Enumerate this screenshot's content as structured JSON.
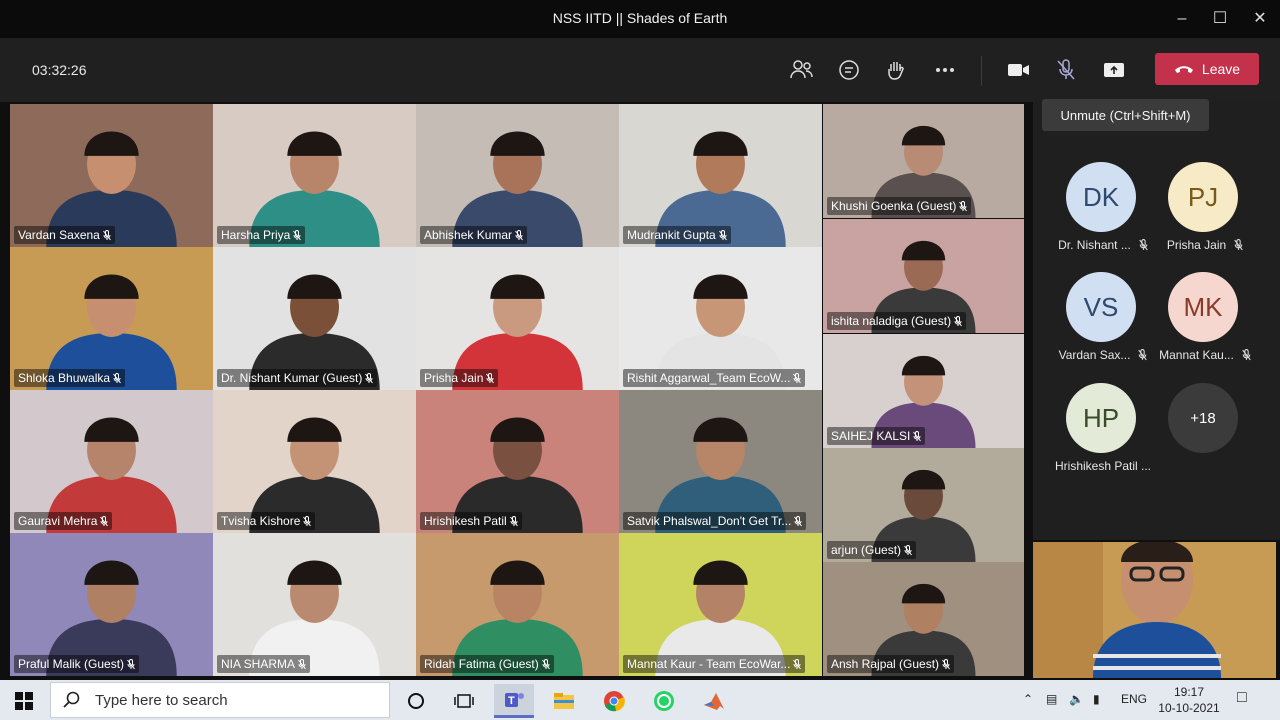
{
  "window": {
    "title": "NSS IITD || Shades of Earth",
    "minimize_icon": "minimize-icon",
    "maximize_icon": "maximize-icon",
    "close_icon": "close-icon"
  },
  "toolbar": {
    "timer": "03:32:26",
    "leave_label": "Leave",
    "tooltip": "Unmute (Ctrl+Shift+M)",
    "icons": [
      "participants-icon",
      "chat-icon",
      "raise-hand-icon",
      "more-options-icon",
      "camera-icon",
      "mic-muted-icon",
      "share-screen-icon",
      "phone-hangup-icon"
    ],
    "leave_color": "#c4314b"
  },
  "participants": [
    {
      "name": "Vardan Saxena",
      "bg": "#8d6a59",
      "skin": "#c69070",
      "shirt": "#2a3a5a"
    },
    {
      "name": "Harsha Priya",
      "bg": "#d8cbc3",
      "skin": "#b9856a",
      "shirt": "#2e8f86"
    },
    {
      "name": "Abhishek Kumar",
      "bg": "#c5bdb5",
      "skin": "#a87358",
      "shirt": "#3a4a6a"
    },
    {
      "name": "Mudrankit Gupta",
      "bg": "#d9d7d2",
      "skin": "#b07a5b",
      "shirt": "#4a6a94"
    },
    {
      "name": "Khushi Goenka (Guest)",
      "bg": "#b8aaa0",
      "skin": "#b78b74",
      "shirt": "#5a5050"
    },
    {
      "name": "Shloka Bhuwalka",
      "bg": "#c89b55",
      "skin": "#c58f70",
      "shirt": "#1d4f9a"
    },
    {
      "name": "Dr. Nishant Kumar (Guest)",
      "bg": "#e2e2e2",
      "skin": "#7a5038",
      "shirt": "#2b2b2b"
    },
    {
      "name": "Prisha Jain",
      "bg": "#e6e4e2",
      "skin": "#c99a80",
      "shirt": "#d3343a"
    },
    {
      "name": "Rishit Aggarwal_Team EcoW...",
      "bg": "#e8e8e8",
      "skin": "#c79676",
      "shirt": "#e4e4e4"
    },
    {
      "name": "ishita naladiga (Guest)",
      "bg": "#c9a2a2",
      "skin": "#9a6a55",
      "shirt": "#3a3a3a"
    },
    {
      "name": "SAIHEJ KALSI",
      "bg": "#d8d0ce",
      "skin": "#c39278",
      "shirt": "#6a4a7a"
    },
    {
      "name": "Gauravi Mehra",
      "bg": "#d3c8cb",
      "skin": "#b6846a",
      "shirt": "#c33a3a"
    },
    {
      "name": "Tvisha Kishore",
      "bg": "#e2d4c9",
      "skin": "#c49376",
      "shirt": "#2b2b2b"
    },
    {
      "name": "Hrishikesh Patil",
      "bg": "#c9837a",
      "skin": "#7a5040",
      "shirt": "#2a2a2a"
    },
    {
      "name": "Satvik Phalswal_Don't Get Tr...",
      "bg": "#8c8880",
      "skin": "#b78568",
      "shirt": "#2f5f7a"
    },
    {
      "name": "arjun (Guest)",
      "bg": "#b2aa9a",
      "skin": "#6a4a3a",
      "shirt": "#3a3a3a"
    },
    {
      "name": "Praful Malik (Guest)",
      "bg": "#8f88b8",
      "skin": "#b08065",
      "shirt": "#3a3a5a"
    },
    {
      "name": "NIA SHARMA",
      "bg": "#e2e0dc",
      "skin": "#b98a70",
      "shirt": "#f1f1f1"
    },
    {
      "name": "Ridah Fatima (Guest)",
      "bg": "#c79a6e",
      "skin": "#b98463",
      "shirt": "#2f8f62"
    },
    {
      "name": "Mannat Kaur - Team EcoWar...",
      "bg": "#cfd45a",
      "skin": "#b48266",
      "shirt": "#e9e9e9"
    },
    {
      "name": "Ansh Rajpal (Guest)",
      "bg": "#a09080",
      "skin": "#b08062",
      "shirt": "#3a3a3a"
    }
  ],
  "sidebar": [
    {
      "initials": "DK",
      "name": "Dr. Nishant ...",
      "color": "#d0dff1",
      "text": "#2f4a6f"
    },
    {
      "initials": "PJ",
      "name": "Prisha Jain",
      "color": "#f7eac6",
      "text": "#7a5a1a"
    },
    {
      "initials": "VS",
      "name": "Vardan Sax...",
      "color": "#d0dff1",
      "text": "#2f4a6f"
    },
    {
      "initials": "MK",
      "name": "Mannat Kau...",
      "color": "#f5d7d0",
      "text": "#8a3a2a"
    },
    {
      "initials": "HP",
      "name": "Hrishikesh Patil ...",
      "color": "#e3ead8",
      "text": "#3a4a2a"
    },
    {
      "initials": "+18",
      "name": "",
      "color": "#3b3b3b",
      "text": "#ffffff"
    }
  ],
  "taskbar": {
    "search_placeholder": "Type here to search",
    "apps": [
      "task-view-icon",
      "teams-icon",
      "file-explorer-icon",
      "chrome-icon",
      "whatsapp-icon",
      "matlab-icon"
    ],
    "lang": "ENG",
    "time": "19:17",
    "date": "10-10-2021"
  }
}
